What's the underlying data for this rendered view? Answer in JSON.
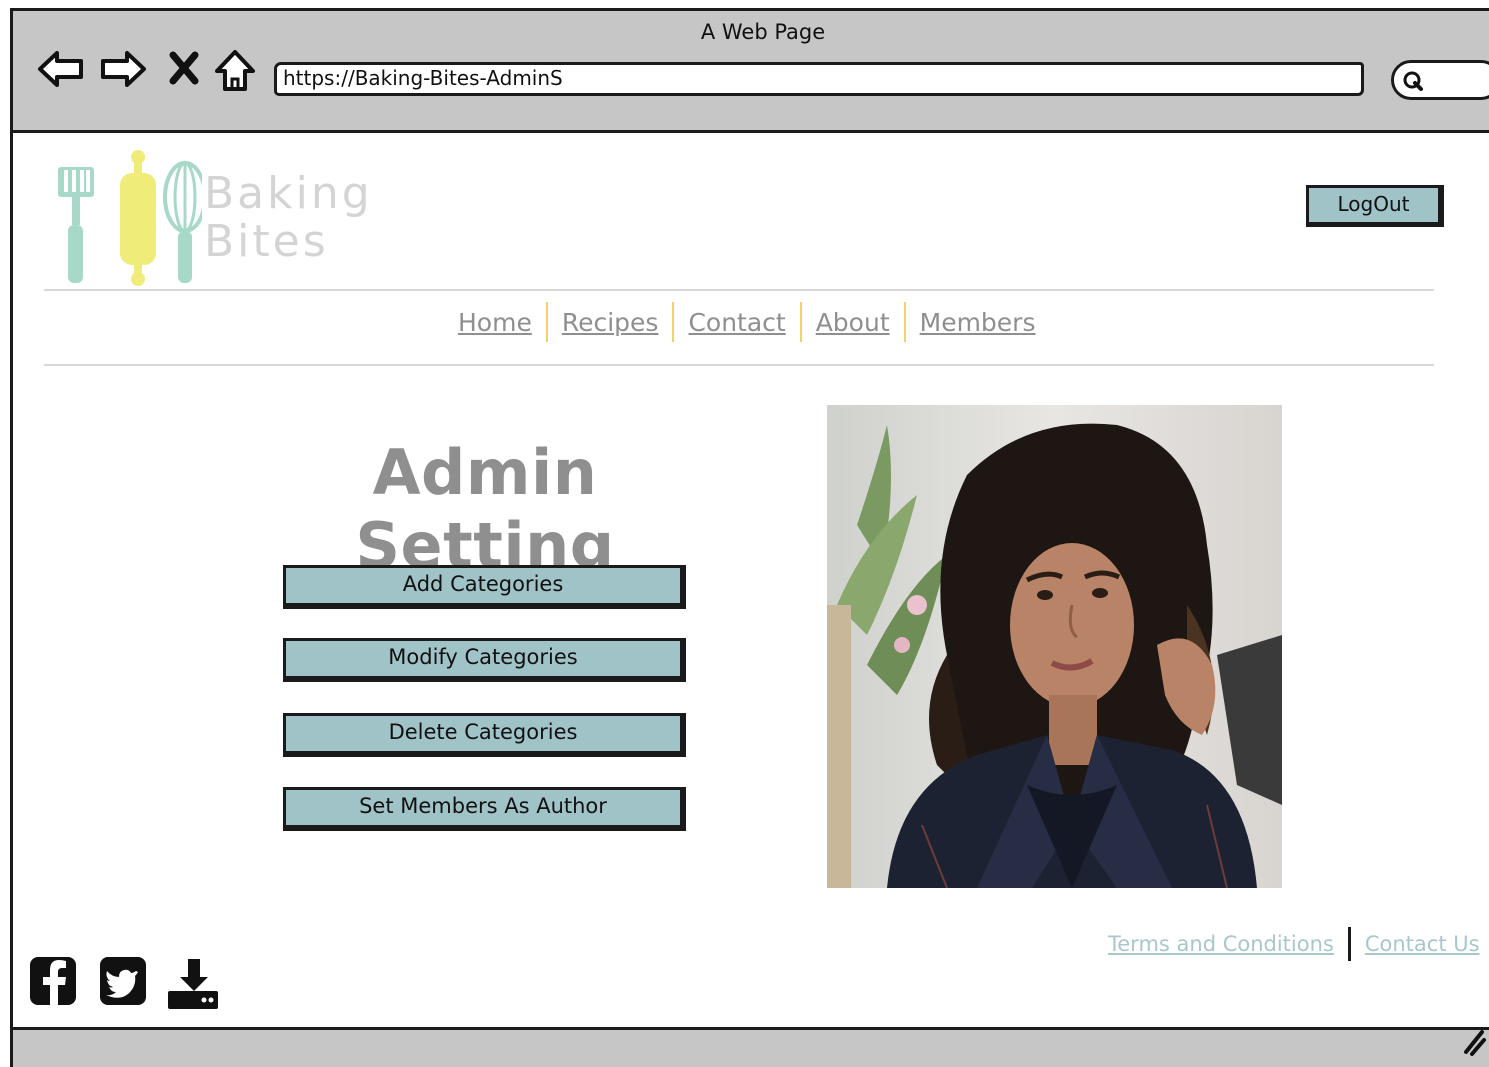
{
  "window": {
    "title": "A Web Page",
    "url": "https://Baking-Bites-AdminS",
    "nav_icons": [
      "back-arrow-icon",
      "forward-arrow-icon",
      "stop-icon",
      "home-icon"
    ],
    "search_icon": "search-icon"
  },
  "header": {
    "logo_line1": "Baking",
    "logo_line2": "Bites",
    "logout_label": "LogOut"
  },
  "nav": {
    "items": [
      {
        "label": "Home"
      },
      {
        "label": "Recipes"
      },
      {
        "label": "Contact"
      },
      {
        "label": "About"
      },
      {
        "label": "Members"
      }
    ],
    "separator_color": "#f5d06b"
  },
  "main": {
    "title": "Admin Setting",
    "buttons": [
      {
        "label": "Add Categories"
      },
      {
        "label": "Modify Categories"
      },
      {
        "label": "Delete Categories"
      },
      {
        "label": "Set Members As Author"
      }
    ]
  },
  "footer": {
    "links": [
      {
        "label": "Terms and Conditions"
      },
      {
        "label": "Contact Us"
      }
    ],
    "social_icons": [
      "facebook-icon",
      "twitter-icon",
      "download-icon"
    ]
  },
  "colors": {
    "button_fill": "#a0c3c8",
    "chrome_gray": "#c6c6c6",
    "link_gray": "#8f8f8f",
    "footer_link": "#a8c7cc"
  }
}
